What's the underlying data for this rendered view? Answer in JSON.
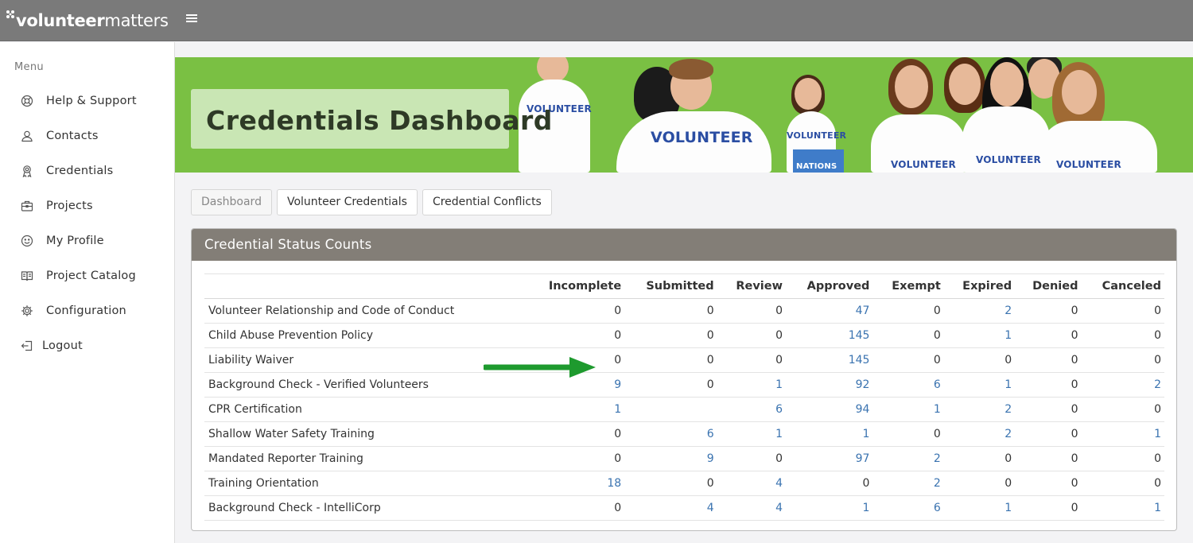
{
  "app": {
    "logo_bold": "volunteer",
    "logo_light": "matters"
  },
  "sidebar": {
    "menu_title": "Menu",
    "items": [
      {
        "label": "Help & Support",
        "icon": "lifebuoy-icon"
      },
      {
        "label": "Contacts",
        "icon": "contacts-icon"
      },
      {
        "label": "Credentials",
        "icon": "credentials-icon"
      },
      {
        "label": "Projects",
        "icon": "briefcase-icon"
      },
      {
        "label": "My Profile",
        "icon": "smiley-icon"
      },
      {
        "label": "Project Catalog",
        "icon": "book-icon"
      },
      {
        "label": "Configuration",
        "icon": "gear-icon"
      },
      {
        "label": "Logout",
        "icon": "logout-icon"
      }
    ]
  },
  "banner": {
    "title": "Credentials Dashboard",
    "shirt_text": "VOLUNTEER",
    "box_text": "NATIONS"
  },
  "tabs": [
    {
      "label": "Dashboard",
      "active": true
    },
    {
      "label": "Volunteer Credentials",
      "active": false
    },
    {
      "label": "Credential Conflicts",
      "active": false
    }
  ],
  "panel": {
    "title": "Credential Status Counts",
    "columns": [
      "",
      "Incomplete",
      "Submitted",
      "Review",
      "Approved",
      "Exempt",
      "Expired",
      "Denied",
      "Canceled"
    ],
    "rows": [
      {
        "name": "Volunteer Relationship and Code of Conduct",
        "values": [
          "0",
          "0",
          "0",
          "47",
          "0",
          "2",
          "0",
          "0"
        ]
      },
      {
        "name": "Child Abuse Prevention Policy",
        "values": [
          "0",
          "0",
          "0",
          "145",
          "0",
          "1",
          "0",
          "0"
        ]
      },
      {
        "name": "Liability Waiver",
        "values": [
          "0",
          "0",
          "0",
          "145",
          "0",
          "0",
          "0",
          "0"
        ]
      },
      {
        "name": "Background Check - Verified Volunteers",
        "values": [
          "9",
          "0",
          "1",
          "92",
          "6",
          "1",
          "0",
          "2"
        ]
      },
      {
        "name": "CPR Certification",
        "values": [
          "1",
          "",
          "6",
          "94",
          "1",
          "2",
          "0",
          "0"
        ]
      },
      {
        "name": "Shallow Water Safety Training",
        "values": [
          "0",
          "6",
          "1",
          "1",
          "0",
          "2",
          "0",
          "1"
        ]
      },
      {
        "name": "Mandated Reporter Training",
        "values": [
          "0",
          "9",
          "0",
          "97",
          "2",
          "0",
          "0",
          "0"
        ]
      },
      {
        "name": "Training Orientation",
        "values": [
          "18",
          "0",
          "4",
          "0",
          "2",
          "0",
          "0",
          "0"
        ]
      },
      {
        "name": "Background Check - IntelliCorp",
        "values": [
          "0",
          "4",
          "4",
          "1",
          "6",
          "1",
          "0",
          "1"
        ]
      }
    ]
  },
  "colors": {
    "topbar": "#7a7a7a",
    "banner_green": "#7ac043",
    "panel_header": "#837e77",
    "link_blue": "#3a73b0",
    "arrow_green": "#1e9a2e"
  }
}
